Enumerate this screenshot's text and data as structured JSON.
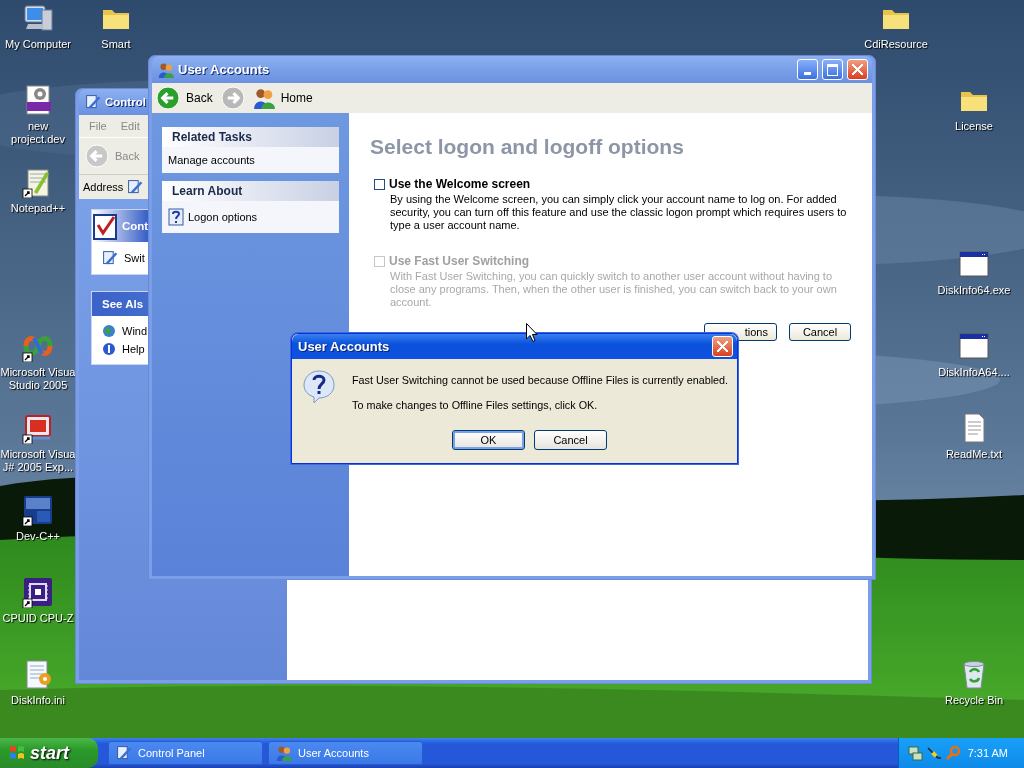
{
  "desktop_icons": [
    {
      "label": "My Computer",
      "kind": "computer"
    },
    {
      "label": "new project.dev",
      "kind": "dev-file"
    },
    {
      "label": "Notepad++",
      "kind": "notepad"
    },
    {
      "label": "Microsoft Visua\nStudio 2005",
      "kind": "studio"
    },
    {
      "label": "Microsoft Visua\nJ# 2005 Exp...",
      "kind": "vj"
    },
    {
      "label": "Dev-C++",
      "kind": "devcpp"
    },
    {
      "label": "CPUID CPU-Z",
      "kind": "chip"
    },
    {
      "label": "DiskInfo.ini",
      "kind": "ini"
    },
    {
      "label": "Smart",
      "kind": "folder"
    },
    {
      "label": "CdiResource",
      "kind": "folder"
    },
    {
      "label": "License",
      "kind": "folder"
    },
    {
      "label": "DiskInfo64.exe",
      "kind": "exe"
    },
    {
      "label": "DiskInfoA64....",
      "kind": "exe"
    },
    {
      "label": "ReadMe.txt",
      "kind": "txt"
    },
    {
      "label": "Recycle Bin",
      "kind": "recycle"
    }
  ],
  "control_panel_window": {
    "title": "Control",
    "menu": [
      "File",
      "Edit"
    ],
    "back": "Back",
    "address_label": "Address",
    "tasks_box": {
      "title": "Cont",
      "items": [
        "Swit"
      ]
    },
    "see_also_box": {
      "title": "See Als",
      "items": [
        "Wind",
        "Help"
      ]
    }
  },
  "user_accounts_window": {
    "title": "User Accounts",
    "toolbar": {
      "back": "Back",
      "home": "Home"
    },
    "related_tasks": {
      "title": "Related Tasks",
      "items": [
        "Manage accounts"
      ]
    },
    "learn_about": {
      "title": "Learn About",
      "items": [
        "Logon options"
      ]
    },
    "heading": "Select logon and logoff options",
    "options": [
      {
        "label": "Use the Welcome screen",
        "description": "By using the Welcome screen, you can simply click your account name to log on. For added security, you can turn off this feature and use the classic logon prompt which requires users to type a user account name.",
        "checked": false,
        "disabled": false
      },
      {
        "label": "Use Fast User Switching",
        "description": "With Fast User Switching, you can quickly switch to another user account without having to close any programs. Then, when the other user is finished, you can switch back to your own account.",
        "checked": false,
        "disabled": true
      }
    ],
    "buttons": [
      "tions",
      "Cancel"
    ]
  },
  "dialog": {
    "title": "User Accounts",
    "message": "Fast User Switching cannot be used because Offline Files is currently enabled.",
    "hint": "To make changes to Offline Files settings, click OK.",
    "buttons": [
      "OK",
      "Cancel"
    ]
  },
  "taskbar": {
    "start": "start",
    "tasks": [
      {
        "label": "Control Panel",
        "kind": "control-panel"
      },
      {
        "label": "User Accounts",
        "kind": "users"
      }
    ],
    "clock": "7:31 AM"
  }
}
